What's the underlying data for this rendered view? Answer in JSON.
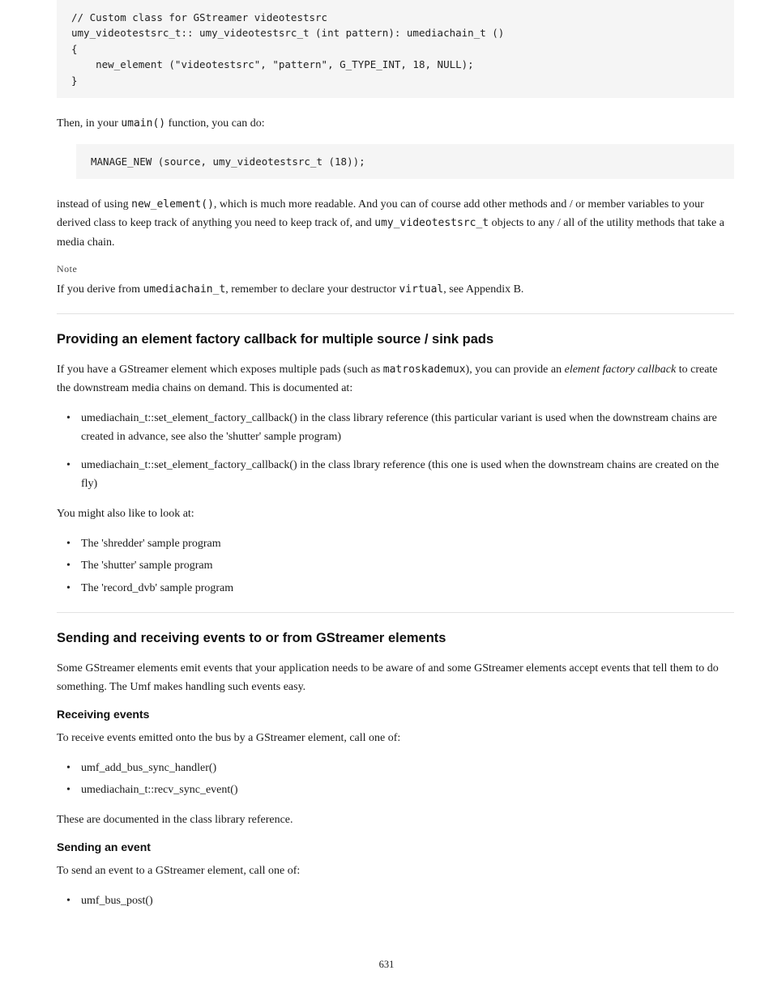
{
  "page_number": "631",
  "code1": "// Custom class for GStreamer videotestsrc\numy_videotestsrc_t:: umy_videotestsrc_t (int pattern): umediachain_t ()\n{\n    new_element (\"videotestsrc\", \"pattern\", G_TYPE_INT, 18, NULL);\n}",
  "para1": {
    "prefix": "Then, in your ",
    "mono1": "umain()",
    "mid": " function, you can do:",
    "code": "MANAGE_NEW (source, umy_videotestsrc_t (18));",
    "after1_prefix": "instead of using ",
    "after1_mono": "new_element()",
    "after1_rest": ", which is much more readable. And you can of course add other methods and / or member variables to your derived class to keep track of anything you need to keep track of, and ",
    "after1_mono2": "umy_videotestsrc_t",
    "after1_tail": " objects to any / all of the utility methods that take a media chain."
  },
  "note": {
    "label": "Note",
    "text_prefix": "If you derive from ",
    "mono1": "umediachain_t",
    "mid1": ", remember to declare your destructor ",
    "mono2": "virtual",
    "tail": ", see Appendix B."
  },
  "sectionA": {
    "title": "Providing an element factory callback for multiple source / sink pads",
    "para_prefix": "If you have a GStreamer element which exposes multiple pads (such as ",
    "mono1": "matroskademux",
    "mid1": "), you can provide an ",
    "italic": "element factory callback",
    "tail": " to create the downstream media chains on demand. This is documented at:",
    "bullets": [
      "umediachain_t::set_element_factory_callback() in the class library reference (this particular variant is used when the downstream chains are created in advance, see also the 'shutter' sample program)",
      "umediachain_t::set_element_factory_callback() in the class lbrary reference (this one is used when the downstream chains are created on the fly)"
    ],
    "after_para": "You might also like to look at:",
    "after_bullets": [
      "The 'shredder' sample program",
      "The 'shutter' sample program",
      "The 'record_dvb' sample program"
    ]
  },
  "sectionB": {
    "title": "Sending and receiving events to or from GStreamer elements",
    "para": "Some GStreamer elements emit events that your application needs to be aware of and some GStreamer elements accept events that tell them to do something. The Umf makes handling such events easy.",
    "sub1": {
      "title": "Receiving events",
      "lead": "To receive events emitted onto the bus by a GStreamer element, call one of:",
      "bullets": [
        "umf_add_bus_sync_handler()",
        "umediachain_t::recv_sync_event()"
      ],
      "tail": "These are documented in the class library reference."
    },
    "sub2": {
      "title": "Sending an event",
      "lead": "To send an event to a GStreamer element, call one of:",
      "bullets": [
        "umf_bus_post()"
      ]
    }
  }
}
